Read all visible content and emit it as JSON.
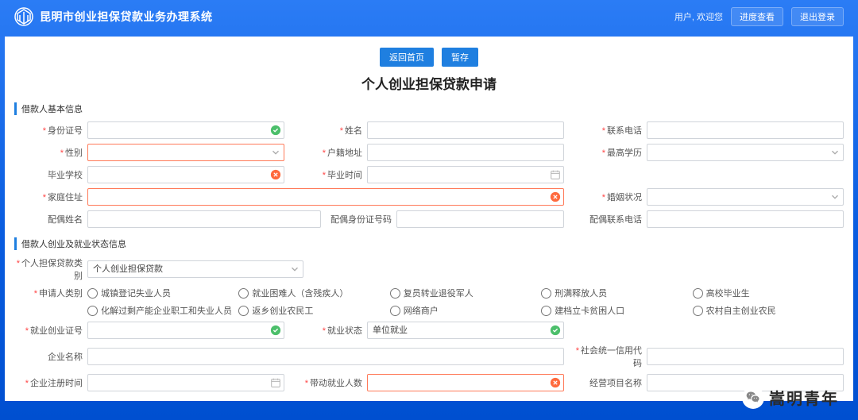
{
  "header": {
    "app_title": "昆明市创业担保贷款业务办理系统",
    "welcome_prefix": "用户, 欢迎您",
    "progress_btn": "进度查看",
    "logout_btn": "退出登录"
  },
  "actions": {
    "back": "返回首页",
    "draft": "暂存"
  },
  "page_title": "个人创业担保贷款申请",
  "sections": {
    "basic": "借款人基本信息",
    "biz": "借款人创业及就业状态信息"
  },
  "labels": {
    "id_no": "身份证号",
    "name": "姓名",
    "phone": "联系电话",
    "gender": "性别",
    "hukou": "户籍地址",
    "edu": "最高学历",
    "school": "毕业学校",
    "grad_time": "毕业时间",
    "home_addr": "家庭住址",
    "marriage": "婚姻状况",
    "spouse_name": "配偶姓名",
    "spouse_id": "配偶身份证号码",
    "spouse_phone": "配偶联系电话",
    "loan_type": "个人担保贷款类别",
    "loan_type_value": "个人创业担保贷款",
    "applicant_cat": "申请人类别",
    "biz_cert": "就业创业证号",
    "emp_status": "就业状态",
    "emp_status_value": "单位就业",
    "usci": "社会统一信用代码",
    "company": "企业名称",
    "reg_time": "企业注册时间",
    "headcount": "带动就业人数",
    "proj_name": "经营项目名称"
  },
  "radios": {
    "r1": "城镇登记失业人员",
    "r2": "就业困难人（含残疾人）",
    "r3": "复员转业退役军人",
    "r4": "刑满释放人员",
    "r5": "高校毕业生",
    "r6": "化解过剩产能企业职工和失业人员",
    "r7": "返乡创业农民工",
    "r8": "网络商户",
    "r9": "建档立卡贫困人口",
    "r10": "农村自主创业农民"
  },
  "values": {
    "id_no": "",
    "name": "",
    "phone": "",
    "biz_cert": ""
  },
  "watermark": "嵩明青年"
}
